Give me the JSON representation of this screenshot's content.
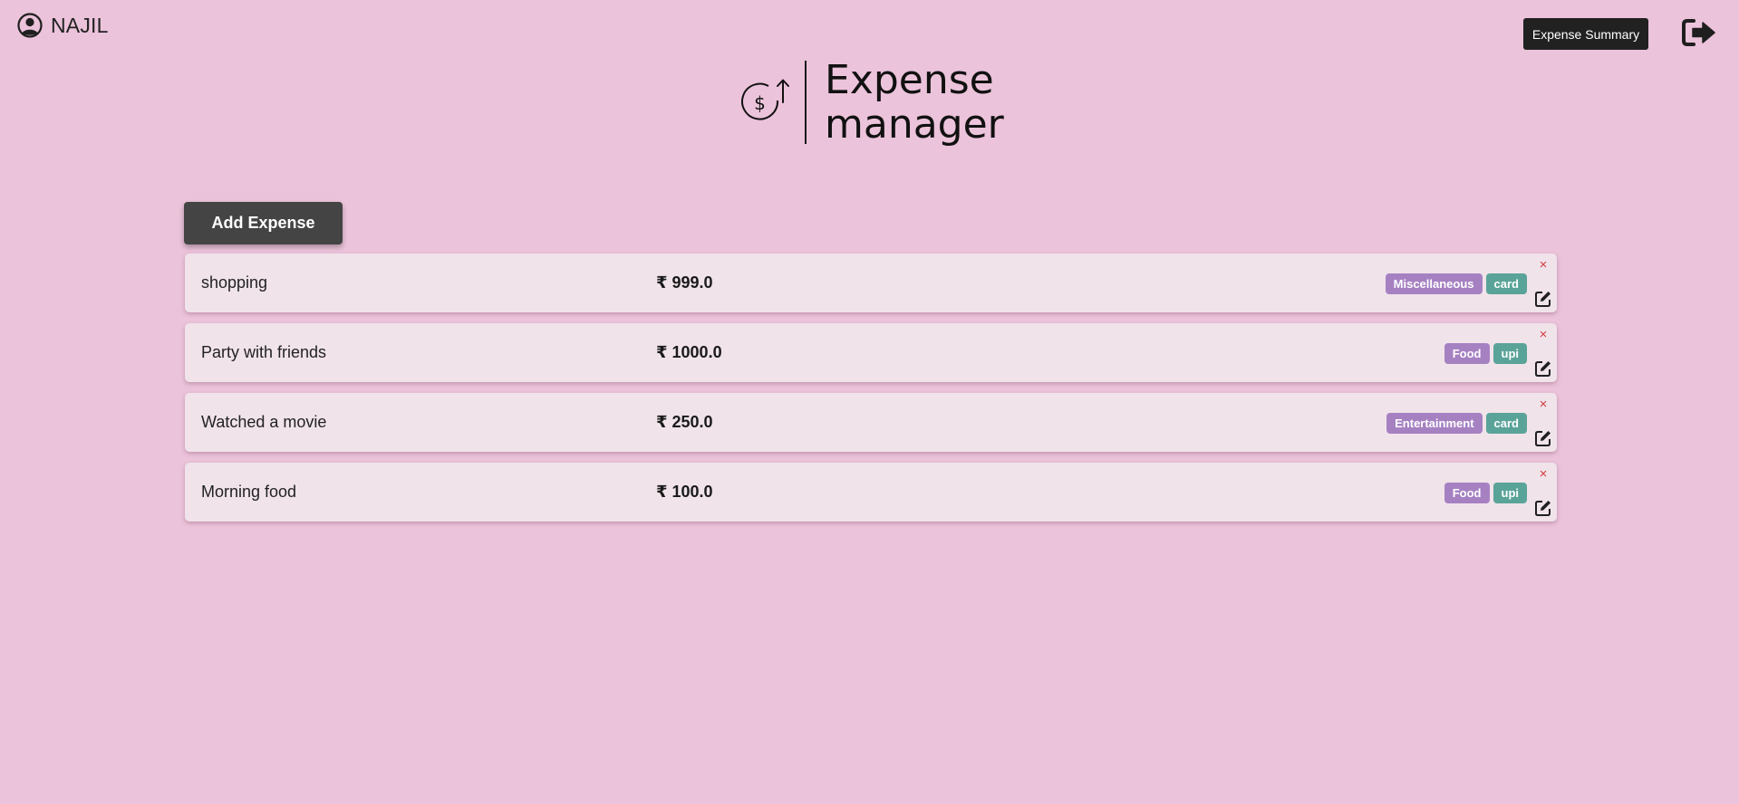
{
  "user": {
    "name": "NAJIL",
    "icon": "user-circle-icon"
  },
  "header": {
    "summary_label": "Expense Summary",
    "logout_icon": "logout-icon"
  },
  "logo": {
    "line1": "Expense",
    "line2": "manager",
    "icon": "dollar-arrow-icon"
  },
  "actions": {
    "add_label": "Add Expense"
  },
  "expenses": [
    {
      "description": "shopping",
      "amount": "₹ 999.0",
      "category": "Miscellaneous",
      "payment": "card"
    },
    {
      "description": "Party with friends",
      "amount": "₹ 1000.0",
      "category": "Food",
      "payment": "upi"
    },
    {
      "description": "Watched a movie",
      "amount": "₹ 250.0",
      "category": "Entertainment",
      "payment": "card"
    },
    {
      "description": "Morning food",
      "amount": "₹ 100.0",
      "category": "Food",
      "payment": "upi"
    }
  ],
  "icons": {
    "delete": "×",
    "edit": "edit-icon"
  },
  "colors": {
    "background": "#ebc3da",
    "card": "#f0e3ea",
    "category_tag": "#a681c2",
    "payment_tag": "#5aa398",
    "delete": "#d23b3b",
    "dark_button": "#212121"
  }
}
